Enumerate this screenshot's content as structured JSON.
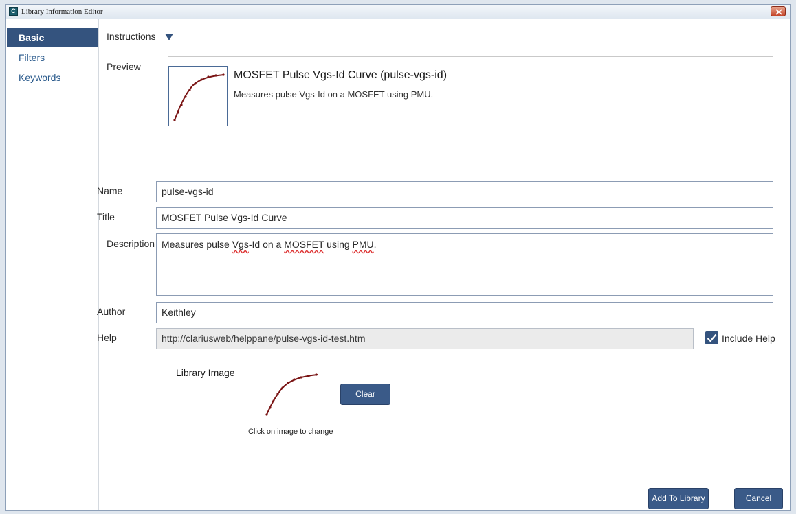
{
  "window": {
    "title": "Library Information Editor",
    "app_icon_letter": "C"
  },
  "sidebar": {
    "items": [
      {
        "label": "Basic",
        "active": true
      },
      {
        "label": "Filters",
        "active": false
      },
      {
        "label": "Keywords",
        "active": false
      }
    ]
  },
  "instructions": {
    "label": "Instructions"
  },
  "preview": {
    "label": "Preview",
    "title": "MOSFET Pulse Vgs-Id Curve (pulse-vgs-id)",
    "description": "Measures pulse Vgs-Id on a MOSFET using PMU."
  },
  "form": {
    "name_label": "Name",
    "name_value": "pulse-vgs-id",
    "title_label": "Title",
    "title_value": "MOSFET Pulse Vgs-Id Curve",
    "description_label": "Description",
    "description_value": {
      "p1": "Measures pulse ",
      "w1": "Vgs",
      "p2": "-Id on a ",
      "w2": "MOSFET",
      "p3": " using ",
      "w3": "PMU",
      "p4": "."
    },
    "author_label": "Author",
    "author_value": "Keithley",
    "help_label": "Help",
    "help_value": "http://clariusweb/helppane/pulse-vgs-id-test.htm",
    "include_help_label": "Include Help",
    "include_help_checked": true
  },
  "library_image": {
    "label": "Library Image",
    "hint": "Click on image to change",
    "clear_label": "Clear"
  },
  "footer": {
    "add_label": "Add To Library",
    "cancel_label": "Cancel"
  },
  "colors": {
    "accent": "#34537e",
    "curve": "#7a1414"
  }
}
